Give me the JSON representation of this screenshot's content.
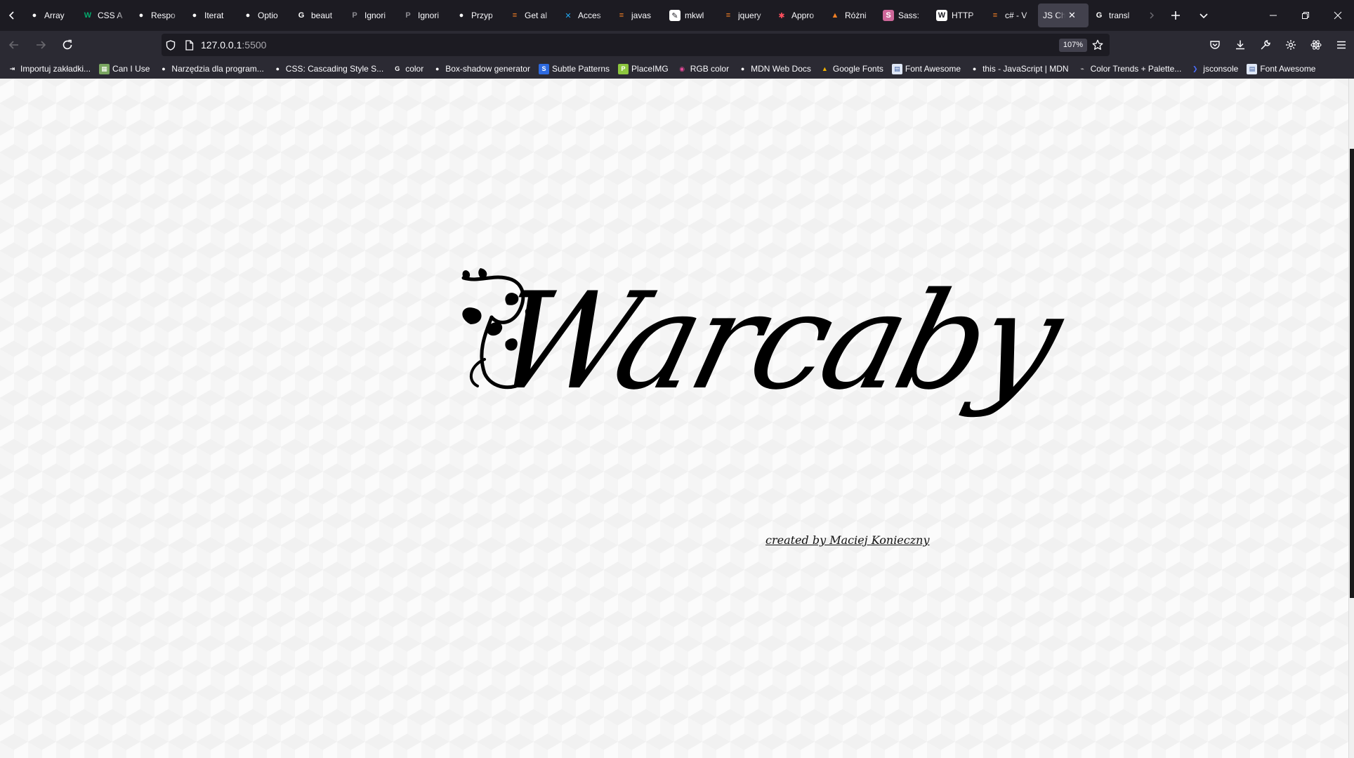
{
  "browser": {
    "tabs": [
      {
        "label": "Array",
        "icon": "github-icon",
        "fav_color": "#ffffff",
        "fav_bg": "#1c1b22",
        "fav_glyph": "●"
      },
      {
        "label": "CSS A",
        "icon": "w3schools-icon",
        "fav_color": "#04aa6d",
        "fav_bg": "#1c1b22",
        "fav_glyph": "W"
      },
      {
        "label": "Respo",
        "icon": "github-icon",
        "fav_color": "#ffffff",
        "fav_bg": "#1c1b22",
        "fav_glyph": "●"
      },
      {
        "label": "Iterat",
        "icon": "github-icon",
        "fav_color": "#ffffff",
        "fav_bg": "#1c1b22",
        "fav_glyph": "●"
      },
      {
        "label": "Optio",
        "icon": "github-icon",
        "fav_color": "#ffffff",
        "fav_bg": "#1c1b22",
        "fav_glyph": "●"
      },
      {
        "label": "beaut",
        "icon": "google-icon",
        "fav_color": "#ffffff",
        "fav_bg": "#1c1b22",
        "fav_glyph": "G"
      },
      {
        "label": "Ignori",
        "icon": "page-icon",
        "fav_color": "#8c8b91",
        "fav_bg": "#1c1b22",
        "fav_glyph": "P"
      },
      {
        "label": "Ignori",
        "icon": "page-icon",
        "fav_color": "#8c8b91",
        "fav_bg": "#1c1b22",
        "fav_glyph": "P"
      },
      {
        "label": "Przyp",
        "icon": "github-icon",
        "fav_color": "#ffffff",
        "fav_bg": "#1c1b22",
        "fav_glyph": "●"
      },
      {
        "label": "Get al",
        "icon": "stackoverflow-icon",
        "fav_color": "#f48024",
        "fav_bg": "#1c1b22",
        "fav_glyph": "≡"
      },
      {
        "label": "Acces",
        "icon": "vscode-icon",
        "fav_color": "#23a8f2",
        "fav_bg": "#1c1b22",
        "fav_glyph": "✕"
      },
      {
        "label": "javas",
        "icon": "stackoverflow-icon",
        "fav_color": "#f48024",
        "fav_bg": "#1c1b22",
        "fav_glyph": "≡"
      },
      {
        "label": "mkwl",
        "icon": "doc-icon",
        "fav_color": "#1c1b22",
        "fav_bg": "#ffffff",
        "fav_glyph": "✎"
      },
      {
        "label": "jquery",
        "icon": "stackoverflow-icon",
        "fav_color": "#f48024",
        "fav_bg": "#1c1b22",
        "fav_glyph": "≡"
      },
      {
        "label": "Appro",
        "icon": "asterisk-icon",
        "fav_color": "#ff4f5e",
        "fav_bg": "#1c1b22",
        "fav_glyph": "✱"
      },
      {
        "label": "Różni",
        "icon": "chart-icon",
        "fav_color": "#f48024",
        "fav_bg": "#1c1b22",
        "fav_glyph": "▲"
      },
      {
        "label": "Sass:",
        "icon": "sass-icon",
        "fav_color": "#ffffff",
        "fav_bg": "#cd6799",
        "fav_glyph": "S"
      },
      {
        "label": "HTTP",
        "icon": "wikipedia-icon",
        "fav_color": "#1c1b22",
        "fav_bg": "#ffffff",
        "fav_glyph": "W"
      },
      {
        "label": "c# - V",
        "icon": "stackoverflow-icon",
        "fav_color": "#f48024",
        "fav_bg": "#1c1b22",
        "fav_glyph": "≡"
      },
      {
        "label": "JS Chec",
        "icon": "none",
        "fav_color": "#ffffff",
        "fav_bg": "#42414d",
        "fav_glyph": "",
        "active": true
      },
      {
        "label": "transl",
        "icon": "google-icon",
        "fav_color": "#ffffff",
        "fav_bg": "#1c1b22",
        "fav_glyph": "G"
      }
    ],
    "address": {
      "host": "127.0.0.1",
      "port": ":5500"
    },
    "zoom": "107%",
    "bookmarks": [
      {
        "label": "Importuj zakładki...",
        "icon": "import-icon",
        "fav_bg": "#2b2a33",
        "fav_color": "#fbfbfe",
        "fav_glyph": "⇥"
      },
      {
        "label": "Can I Use",
        "icon": "caniuse-icon",
        "fav_bg": "#7aa661",
        "fav_color": "#ffffff",
        "fav_glyph": "▦"
      },
      {
        "label": "Narzędzia dla program...",
        "icon": "github-icon",
        "fav_bg": "#2b2a33",
        "fav_color": "#ffffff",
        "fav_glyph": "●"
      },
      {
        "label": "CSS: Cascading Style S...",
        "icon": "mdn-icon",
        "fav_bg": "#2b2a33",
        "fav_color": "#ffffff",
        "fav_glyph": "●"
      },
      {
        "label": "color",
        "icon": "google-icon",
        "fav_bg": "#2b2a33",
        "fav_color": "#ffffff",
        "fav_glyph": "G"
      },
      {
        "label": "Box-shadow generator",
        "icon": "github-icon",
        "fav_bg": "#2b2a33",
        "fav_color": "#ffffff",
        "fav_glyph": "●"
      },
      {
        "label": "Subtle Patterns",
        "icon": "subtle-patterns-icon",
        "fav_bg": "#2d6ae0",
        "fav_color": "#ffffff",
        "fav_glyph": "S"
      },
      {
        "label": "PlaceIMG",
        "icon": "placeimg-icon",
        "fav_bg": "#8cc63e",
        "fav_color": "#ffffff",
        "fav_glyph": "P"
      },
      {
        "label": "RGB color",
        "icon": "color-wheel-icon",
        "fav_bg": "#2b2a33",
        "fav_color": "#e64a9a",
        "fav_glyph": "◉"
      },
      {
        "label": "MDN Web Docs",
        "icon": "mdn-icon",
        "fav_bg": "#2b2a33",
        "fav_color": "#ffffff",
        "fav_glyph": "●"
      },
      {
        "label": "Google Fonts",
        "icon": "google-fonts-icon",
        "fav_bg": "#2b2a33",
        "fav_color": "#f4b400",
        "fav_glyph": "▲"
      },
      {
        "label": "Font Awesome",
        "icon": "page-icon",
        "fav_bg": "#dfe7f5",
        "fav_color": "#3a5ba0",
        "fav_glyph": "▤"
      },
      {
        "label": "this - JavaScript | MDN",
        "icon": "mdn-icon",
        "fav_bg": "#2b2a33",
        "fav_color": "#ffffff",
        "fav_glyph": "●"
      },
      {
        "label": "Color Trends + Palette...",
        "icon": "brush-icon",
        "fav_bg": "#2b2a33",
        "fav_color": "#c9c9c9",
        "fav_glyph": "⌁"
      },
      {
        "label": "jsconsole",
        "icon": "chevron-right-icon",
        "fav_bg": "#2b2a33",
        "fav_color": "#4a6cf7",
        "fav_glyph": "❯"
      },
      {
        "label": "Font Awesome",
        "icon": "page-icon",
        "fav_bg": "#dfe7f5",
        "fav_color": "#3a5ba0",
        "fav_glyph": "▤"
      }
    ]
  },
  "page": {
    "logo_text": "Warcaby",
    "credit": "created by Maciej Konieczny"
  }
}
